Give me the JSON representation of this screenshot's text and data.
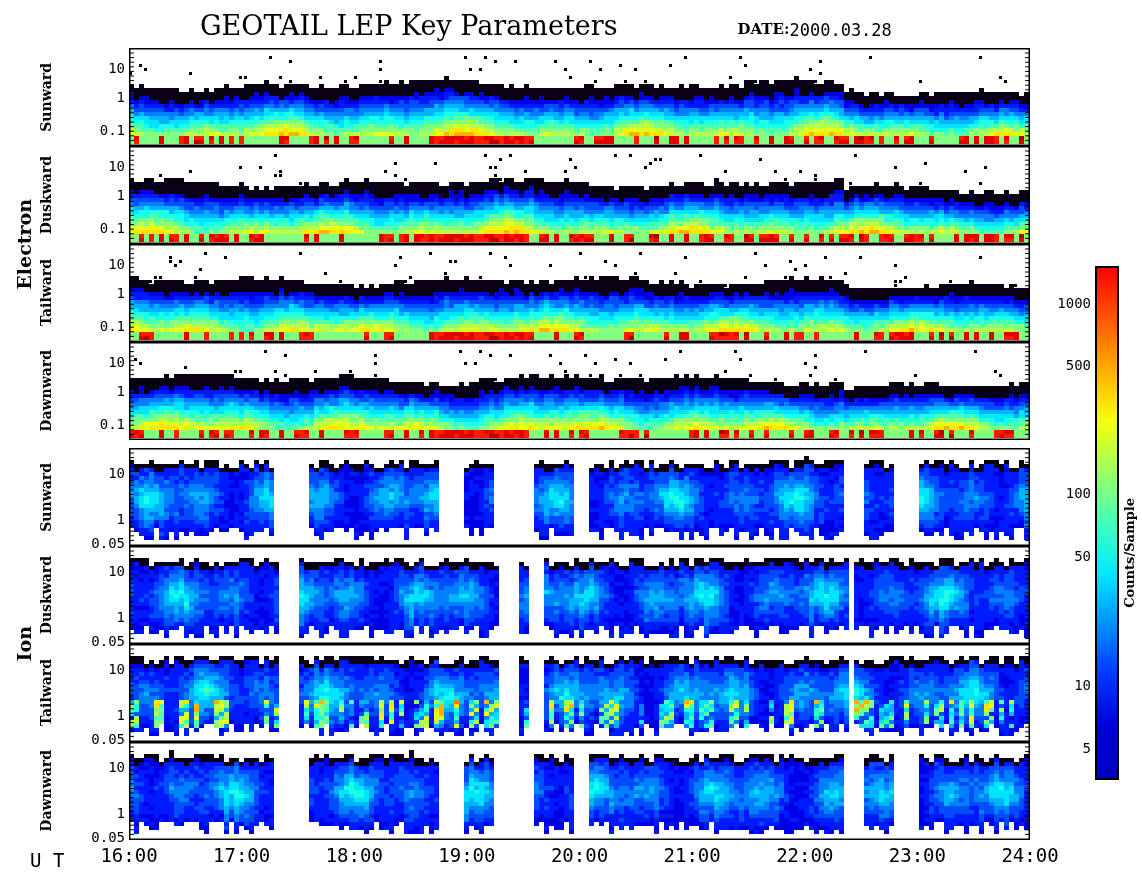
{
  "title": "GEOTAIL LEP Key Parameters",
  "date": {
    "label": "DATE:",
    "value": "2000.03.28"
  },
  "groups": [
    {
      "name": "Electron",
      "kind": "electron",
      "panels": [
        {
          "label": "Sunward",
          "yticks": [
            "10",
            "1",
            "0.1"
          ]
        },
        {
          "label": "Duskward",
          "yticks": [
            "10",
            "1",
            "0.1"
          ]
        },
        {
          "label": "Tailward",
          "yticks": [
            "10",
            "1",
            "0.1"
          ]
        },
        {
          "label": "Dawnward",
          "yticks": [
            "10",
            "1",
            "0.1"
          ]
        }
      ]
    },
    {
      "name": "Ion",
      "kind": "ion",
      "panels": [
        {
          "label": "Sunward",
          "yticks": [
            "10",
            "1",
            "0.05"
          ]
        },
        {
          "label": "Duskward",
          "yticks": [
            "10",
            "1",
            "0.05"
          ]
        },
        {
          "label": "Tailward",
          "yticks": [
            "10",
            "1",
            "0.05"
          ]
        },
        {
          "label": "Dawnward",
          "yticks": [
            "10",
            "1",
            "0.05"
          ]
        }
      ]
    }
  ],
  "x_axis": {
    "label": "U T",
    "ticks": [
      "16:00",
      "17:00",
      "18:00",
      "19:00",
      "20:00",
      "21:00",
      "22:00",
      "23:00",
      "24:00"
    ]
  },
  "colorbar": {
    "label": "Counts/Sample",
    "ticks": [
      "1000",
      "500",
      "100",
      "50",
      "10",
      "5"
    ]
  }
}
